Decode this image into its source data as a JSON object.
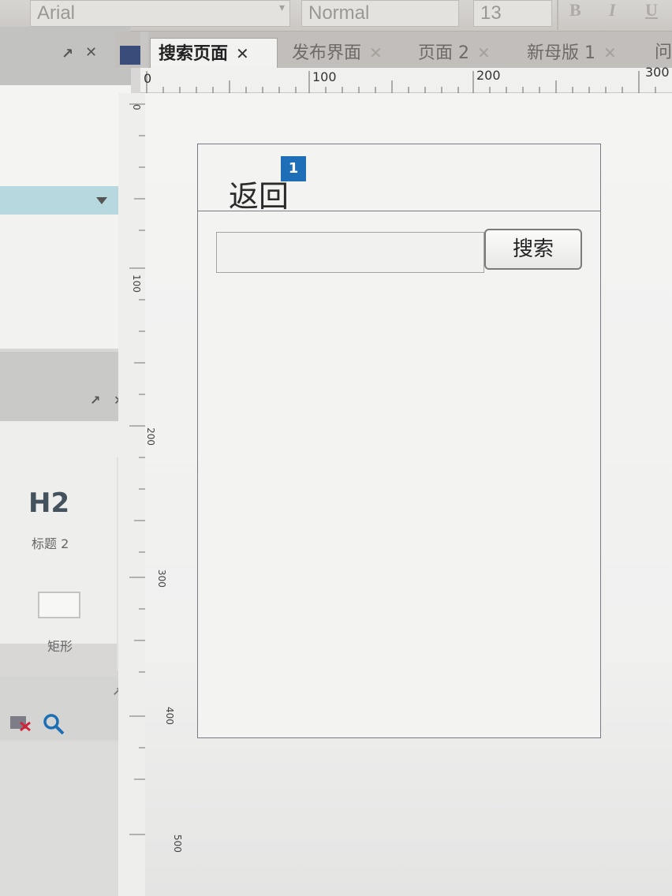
{
  "toolbar": {
    "font_family": "Arial",
    "style": "Normal",
    "font_size": "13",
    "bold": "B",
    "italic": "I",
    "underline": "U"
  },
  "tabs": [
    {
      "label": "搜索页面",
      "active": true
    },
    {
      "label": "发布界面",
      "active": false
    },
    {
      "label": "页面 2",
      "active": false
    },
    {
      "label": "新母版 1",
      "active": false
    },
    {
      "label": "问",
      "active": false
    }
  ],
  "ruler": {
    "h_labels": [
      "0",
      "100",
      "200",
      "300"
    ],
    "v_labels": [
      "0",
      "100",
      "200",
      "300",
      "400",
      "500"
    ]
  },
  "widgets": {
    "h2_icon": "H2",
    "h2_label": "标题 2",
    "rect_label": "矩形"
  },
  "icons": {
    "pin": "pin-icon",
    "close": "close-icon",
    "filter": "filter-icon",
    "search": "search-icon"
  },
  "canvas": {
    "back_label": "返回",
    "badge": "1",
    "search_input_value": "",
    "search_button_label": "搜索"
  }
}
